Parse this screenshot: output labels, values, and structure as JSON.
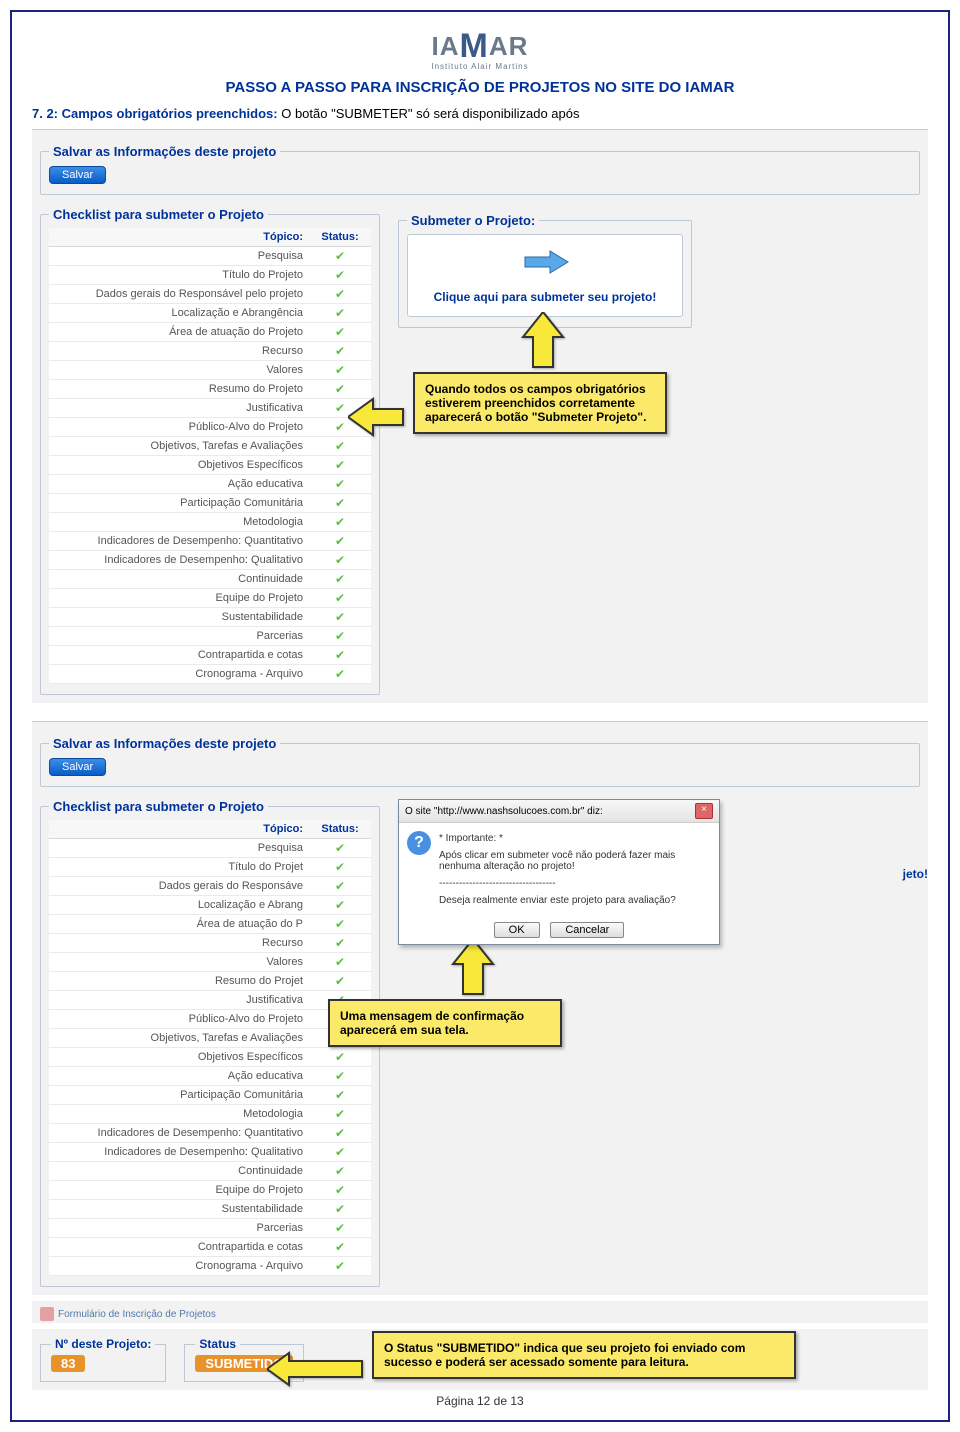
{
  "logo": {
    "name_pre": "IA",
    "name_mid": "M",
    "name_post": "AR",
    "sub": "Instituto Alair Martins"
  },
  "page_title": "PASSO A PASSO PARA INSCRIÇÃO DE PROJETOS NO SITE DO IAMAR",
  "subtitle_prefix": "7. 2: Campos obrigatórios preenchidos: ",
  "subtitle_rest": "O botão \"SUBMETER\" só será disponibilizado após",
  "salvar": {
    "legend": "Salvar as Informações deste projeto",
    "button": "Salvar"
  },
  "checklist_legend": "Checklist para submeter o Projeto",
  "submit_legend": "Submeter o Projeto:",
  "checklist_headers": {
    "topic": "Tópico:",
    "status": "Status:"
  },
  "checklist_items": [
    "Pesquisa",
    "Título do Projeto",
    "Dados gerais do Responsável pelo projeto",
    "Localização e Abrangência",
    "Área de atuação do Projeto",
    "Recurso",
    "Valores",
    "Resumo do Projeto",
    "Justificativa",
    "Público-Alvo do Projeto",
    "Objetivos, Tarefas e Avaliações",
    "Objetivos Específicos",
    "Ação educativa",
    "Participação Comunitária",
    "Metodologia",
    "Indicadores de Desempenho: Quantitativo",
    "Indicadores de Desempenho: Qualitativo",
    "Continuidade",
    "Equipe do Projeto",
    "Sustentabilidade",
    "Parcerias",
    "Contrapartida e cotas",
    "Cronograma - Arquivo"
  ],
  "checklist_items_short": [
    "Pesquisa",
    "Título do Projet",
    "Dados gerais do Responsáve",
    "Localização e Abrang",
    "Área de atuação do P",
    "Recurso",
    "Valores",
    "Resumo do Projet",
    "Justificativa",
    "Público-Alvo do Projeto",
    "Objetivos, Tarefas e Avaliações",
    "Objetivos Específicos",
    "Ação educativa",
    "Participação Comunitária",
    "Metodologia",
    "Indicadores de Desempenho: Quantitativo",
    "Indicadores de Desempenho: Qualitativo",
    "Continuidade",
    "Equipe do Projeto",
    "Sustentabilidade",
    "Parcerias",
    "Contrapartida e cotas",
    "Cronograma - Arquivo"
  ],
  "submit_caption": "Clique aqui para submeter seu projeto!",
  "peek_label": "jeto!",
  "callout1": "Quando todos os campos obrigatórios estiverem preenchidos corretamente aparecerá o botão \"Submeter Projeto\".",
  "callout2": "Uma mensagem de confirmação aparecerá em sua tela.",
  "callout3": "O Status \"SUBMETIDO\" indica que seu projeto foi enviado com sucesso e poderá ser acessado somente para leitura.",
  "dialog": {
    "title": "O site \"http://www.nashsolucoes.com.br\" diz:",
    "line1": "* Importante: *",
    "line2": "Após clicar em submeter você não poderá fazer mais nenhuma alteração no projeto!",
    "sep": "-----------------------------------",
    "line3": "Deseja realmente enviar este projeto para avaliação?",
    "ok": "OK",
    "cancel": "Cancelar"
  },
  "footer_strip": {
    "form_link": "Formulário de Inscrição de Projetos",
    "num_legend": "Nº deste Projeto:",
    "num_value": "83",
    "status_legend": "Status",
    "status_value": "SUBMETIDO"
  },
  "page_footer": "Página 12 de 13"
}
